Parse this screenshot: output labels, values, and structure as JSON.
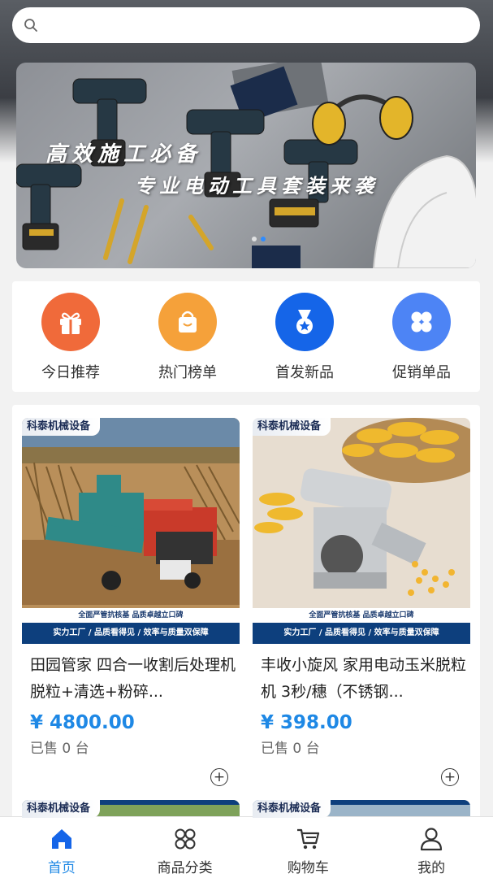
{
  "search": {
    "placeholder": "",
    "icon": "search-icon"
  },
  "banner": {
    "line1": "高效施工必备",
    "line2": "专业电动工具套装来袭",
    "page_count": 2,
    "active_page": 2
  },
  "categories": [
    {
      "label": "今日推荐",
      "icon": "gift-icon",
      "color": "#f06a3a"
    },
    {
      "label": "热门榜单",
      "icon": "shopping-bag-icon",
      "color": "#f5a13a"
    },
    {
      "label": "首发新品",
      "icon": "medal-icon",
      "color": "#1565e8"
    },
    {
      "label": "促销单品",
      "icon": "clover-icon",
      "color": "#4d84f5"
    }
  ],
  "products": [
    {
      "shop": "科泰机械设备",
      "band1": "全面严管抗核基 品质卓越立口碑",
      "band2": "实力工厂 / 品质看得见 / 效率与质量双保障",
      "title": "田园管家 四合一收割后处理机 脱粒+清选+粉碎...",
      "price": "¥ 4800.00",
      "sold": "已售 0 台"
    },
    {
      "shop": "科泰机械设备",
      "band1": "全面严管抗核基 品质卓越立口碑",
      "band2": "实力工厂 / 品质看得见 / 效率与质量双保障",
      "title": "丰收小旋风 家用电动玉米脱粒机 3秒/穗（不锈钢...",
      "price": "¥ 398.00",
      "sold": "已售 0 台"
    },
    {
      "shop": "科泰机械设备"
    },
    {
      "shop": "科泰机械设备"
    }
  ],
  "tabs": [
    {
      "label": "首页",
      "icon": "home-icon",
      "active": true
    },
    {
      "label": "商品分类",
      "icon": "category-grid-icon",
      "active": false
    },
    {
      "label": "购物车",
      "icon": "cart-icon",
      "active": false
    },
    {
      "label": "我的",
      "icon": "user-icon",
      "active": false
    }
  ],
  "colors": {
    "accent": "#1e88e5",
    "shop_tag_text": "#1b2c55"
  }
}
